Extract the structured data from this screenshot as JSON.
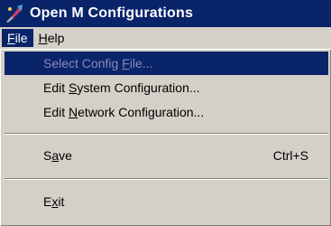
{
  "window": {
    "title": "Open M Configurations",
    "icon": "open-m-app-icon"
  },
  "menubar": {
    "items": [
      {
        "label_prefix": "",
        "mnemonic": "F",
        "label_suffix": "ile",
        "active": true
      },
      {
        "label_prefix": "",
        "mnemonic": "H",
        "label_suffix": "elp",
        "active": false
      }
    ]
  },
  "file_menu": {
    "items": [
      {
        "prefix": "Select Config ",
        "mnemonic": "F",
        "suffix": "ile...",
        "shortcut": "",
        "enabled": false,
        "highlighted": true
      },
      {
        "prefix": "Edit ",
        "mnemonic": "S",
        "suffix": "ystem Configuration...",
        "shortcut": "",
        "enabled": true,
        "highlighted": false
      },
      {
        "prefix": "Edit ",
        "mnemonic": "N",
        "suffix": "etwork Configuration...",
        "shortcut": "",
        "enabled": true,
        "highlighted": false
      },
      {
        "prefix": "S",
        "mnemonic": "a",
        "suffix": "ve",
        "shortcut": "Ctrl+S",
        "enabled": true,
        "highlighted": false
      },
      {
        "prefix": "E",
        "mnemonic": "x",
        "suffix": "it",
        "shortcut": "",
        "enabled": true,
        "highlighted": false
      }
    ]
  },
  "colors": {
    "titlebar": "#0a246a",
    "highlight": "#0a246a",
    "face": "#d4d0c8",
    "disabled_text": "#8a8ab8"
  }
}
